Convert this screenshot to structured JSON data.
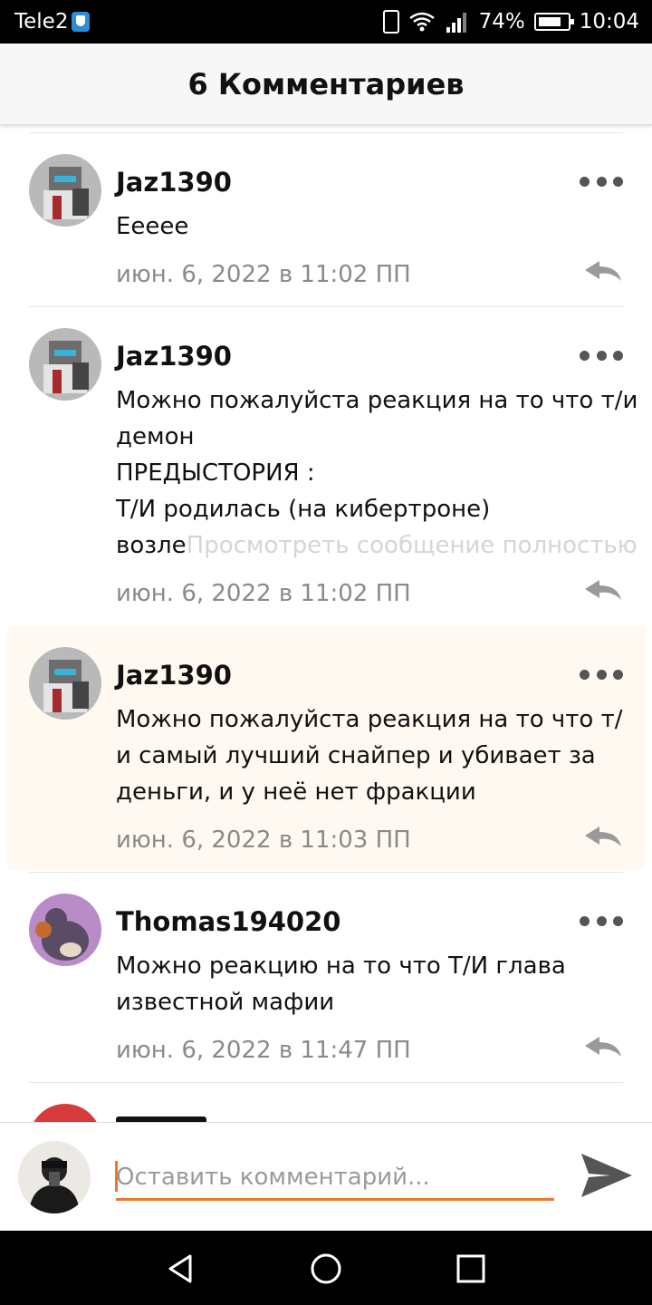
{
  "status_bar": {
    "carrier": "Tele2",
    "battery": "74%",
    "time": "10:04"
  },
  "header": {
    "title": "6 Комментариев"
  },
  "comments": [
    {
      "username": "Jaz1390",
      "body": "Еееее",
      "expand_link": "",
      "timestamp": "июн. 6, 2022 в 11:02 ПП"
    },
    {
      "username": "Jaz1390",
      "body": "Можно пожалуйста реакция на то что т/и\nдемон\nПРЕДЫСТОРИЯ :\nТ/И родилась (на кибертроне)\nвозле",
      "expand_link": "Просмотреть сообщение полностью",
      "timestamp": "июн. 6, 2022 в 11:02 ПП"
    },
    {
      "username": "Jaz1390",
      "body": "Можно пожалуйста реакция на то что т/\nи самый лучший снайпер и убивает за\nденьги, и у неё нет фракции",
      "expand_link": "",
      "timestamp": "июн. 6, 2022 в 11:03 ПП"
    },
    {
      "username": "Thomas194020",
      "body": "Можно реакцию на то что Т/И глава\nизвестной мафии",
      "expand_link": "",
      "timestamp": "июн. 6, 2022 в 11:47 ПП"
    }
  ],
  "composer": {
    "placeholder": "Оставить комментарий..."
  },
  "colors": {
    "accent": "#f2752b",
    "highlight_bg": "#fff9f2",
    "timestamp": "#8a8a8a"
  },
  "icons": [
    "vibrate-icon",
    "wifi-icon",
    "signal-icon",
    "battery-icon",
    "more-icon",
    "reply-icon",
    "send-icon",
    "back-icon",
    "home-icon",
    "recents-icon"
  ]
}
